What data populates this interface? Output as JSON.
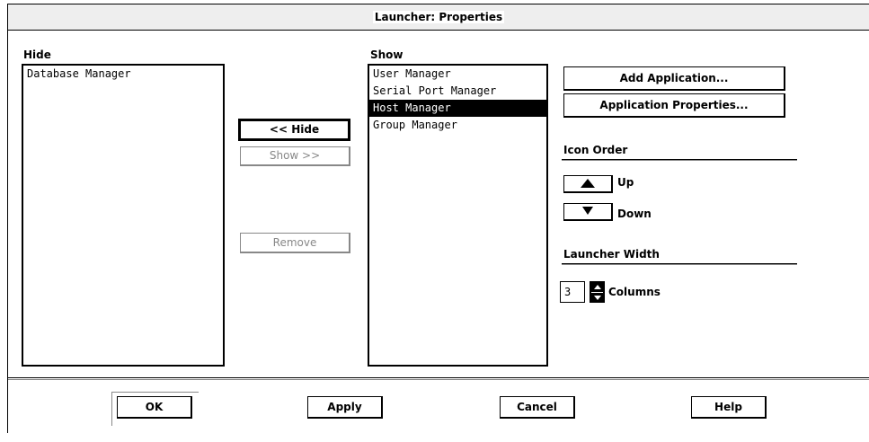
{
  "window": {
    "title": "Launcher: Properties"
  },
  "hide_panel": {
    "label": "Hide",
    "items": [
      "Database Manager"
    ]
  },
  "show_panel": {
    "label": "Show",
    "items": [
      "User Manager",
      "Serial Port Manager",
      "Host Manager",
      "Group Manager"
    ],
    "selected": "Host Manager"
  },
  "transfer": {
    "hide_label": "<< Hide",
    "show_label": "Show >>",
    "remove_label": "Remove"
  },
  "app_actions": {
    "add_label": "Add Application...",
    "properties_label": "Application Properties..."
  },
  "icon_order": {
    "label": "Icon Order",
    "up_label": "Up",
    "down_label": "Down"
  },
  "launcher_width": {
    "label": "Launcher Width",
    "value": "3",
    "unit_label": "Columns"
  },
  "footer": {
    "ok_label": "OK",
    "apply_label": "Apply",
    "cancel_label": "Cancel",
    "help_label": "Help"
  }
}
